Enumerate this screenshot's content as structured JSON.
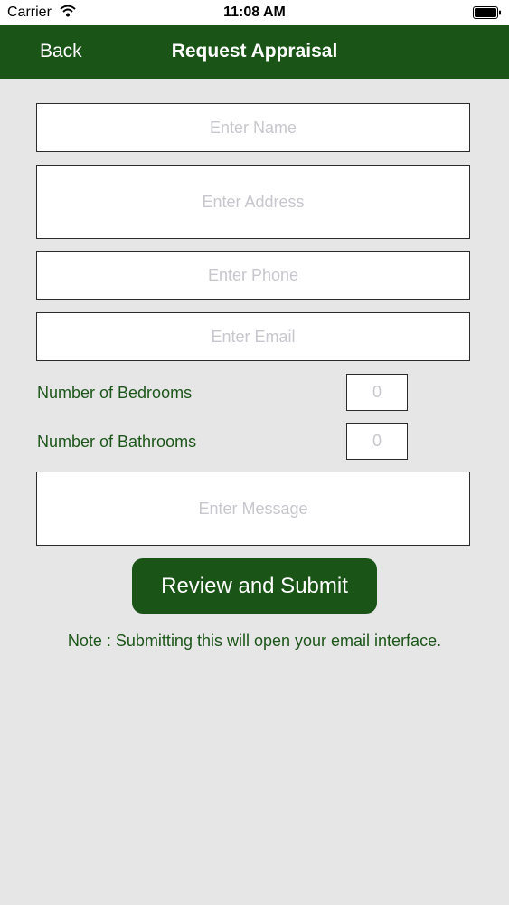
{
  "status_bar": {
    "carrier": "Carrier",
    "time": "11:08 AM",
    "wifi_icon": "wifi-icon",
    "battery_icon": "battery-icon"
  },
  "nav": {
    "back_label": "Back",
    "title": "Request Appraisal",
    "color": "#1a5517"
  },
  "form": {
    "name_placeholder": "Enter Name",
    "address_placeholder": "Enter Address",
    "phone_placeholder": "Enter Phone",
    "email_placeholder": "Enter Email",
    "bedrooms_label": "Number of Bedrooms",
    "bedrooms_value": "0",
    "bathrooms_label": "Number of Bathrooms",
    "bathrooms_value": "0",
    "message_placeholder": "Enter Message",
    "submit_label": "Review and Submit",
    "note": "Note : Submitting this will open your email interface."
  }
}
